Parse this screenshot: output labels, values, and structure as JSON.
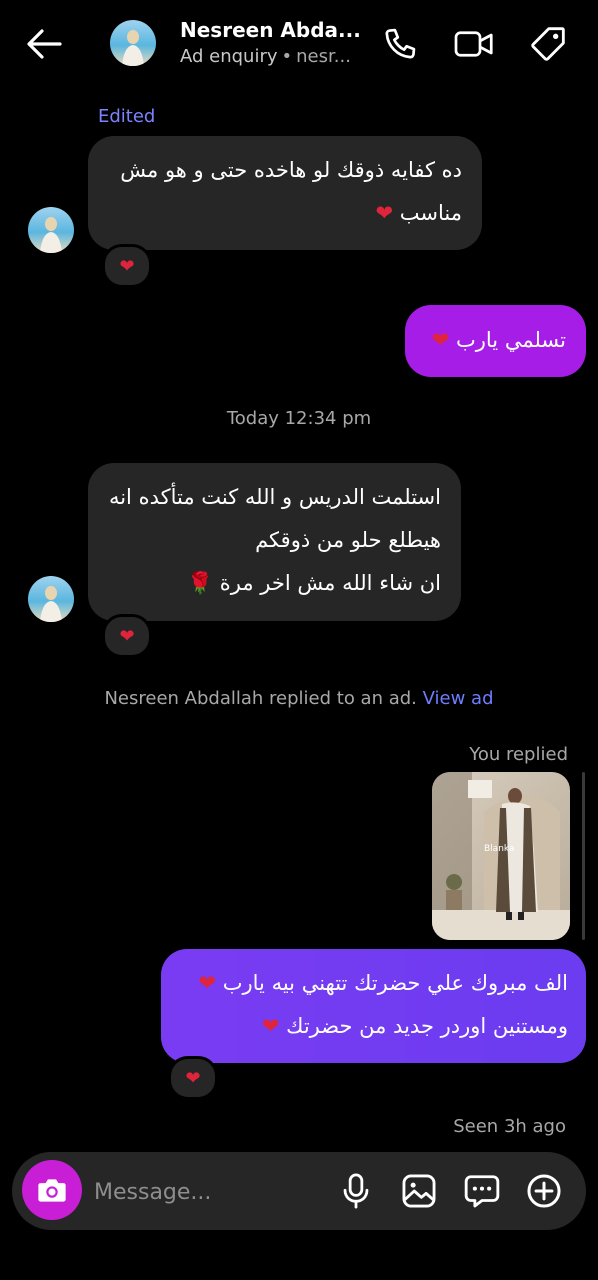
{
  "header": {
    "name": "Nesreen Abda...",
    "sub_label": "Ad enquiry",
    "sub_separator": "•",
    "sub_handle": "nesr..."
  },
  "messages": {
    "edited_label": "Edited",
    "msg1": {
      "line1": "ده كفايه ذوقك لو هاخده حتى و هو مش",
      "line2": "مناسب",
      "heart": "❤",
      "reaction": "❤"
    },
    "msg2": {
      "text": "تسلمي يارب",
      "heart": "❤"
    },
    "timestamp": "Today 12:34 pm",
    "msg3": {
      "line1": "استلمت الدريس و الله كنت متأكده انه",
      "line2": "هيطلع حلو من ذوقكم",
      "line3": "ان شاء الله مش اخر مرة",
      "rose": "🌹",
      "reaction": "❤"
    },
    "ad_notice": {
      "text": "Nesreen Abdallah replied to an ad.",
      "link": "View ad"
    },
    "you_replied": "You replied",
    "ad_image_watermark": "Blanka",
    "msg4": {
      "line1": "الف مبروك علي حضرتك تتهني بيه يارب",
      "line2": "ومستنين اوردر جديد من حضرتك",
      "heart": "❤",
      "reaction": "❤"
    },
    "seen": "Seen 3h ago"
  },
  "composer": {
    "placeholder": "Message..."
  },
  "icons": {
    "back": "arrow-left-icon",
    "call": "phone-icon",
    "video": "video-camera-icon",
    "tag": "tag-icon",
    "camera": "camera-icon",
    "mic": "microphone-icon",
    "gallery": "image-icon",
    "sticker": "chat-bubble-dots-icon",
    "add": "plus-circle-icon"
  },
  "colors": {
    "background": "#000000",
    "incoming_bubble": "#262626",
    "outgoing_gradient_start": "#a01ee8",
    "outgoing_gradient_end": "#6b3cf0",
    "camera_button": "#c81ed6",
    "link": "#6f7dff",
    "edited": "#7b83ff",
    "heart": "#e0243b"
  }
}
